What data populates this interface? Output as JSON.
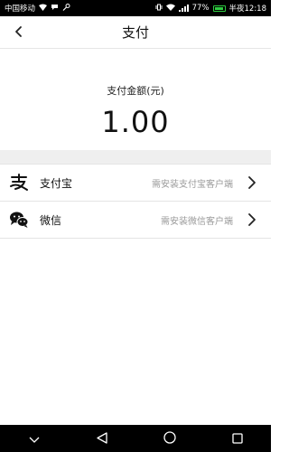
{
  "status_bar": {
    "carrier": "中国移动",
    "battery_percent": "77%",
    "time_label": "半夜12:18",
    "battery_level": 0.77
  },
  "header": {
    "title": "支付",
    "back_icon": "chevron-left-icon"
  },
  "amount": {
    "label": "支付金额(元)",
    "value": "1.00"
  },
  "payment_methods": [
    {
      "name": "支付宝",
      "hint": "需安装支付宝客户端",
      "icon": "alipay-icon"
    },
    {
      "name": "微信",
      "hint": "需安装微信客户端",
      "icon": "wechat-icon"
    }
  ],
  "nav_bar": {
    "icons": [
      "chevron-down-icon",
      "back-triangle-icon",
      "home-circle-icon",
      "recents-square-icon"
    ]
  },
  "colors": {
    "background": "#ffffff",
    "separator": "#efefef",
    "hint_text": "#9a9a9a",
    "bar_background": "#000000"
  }
}
